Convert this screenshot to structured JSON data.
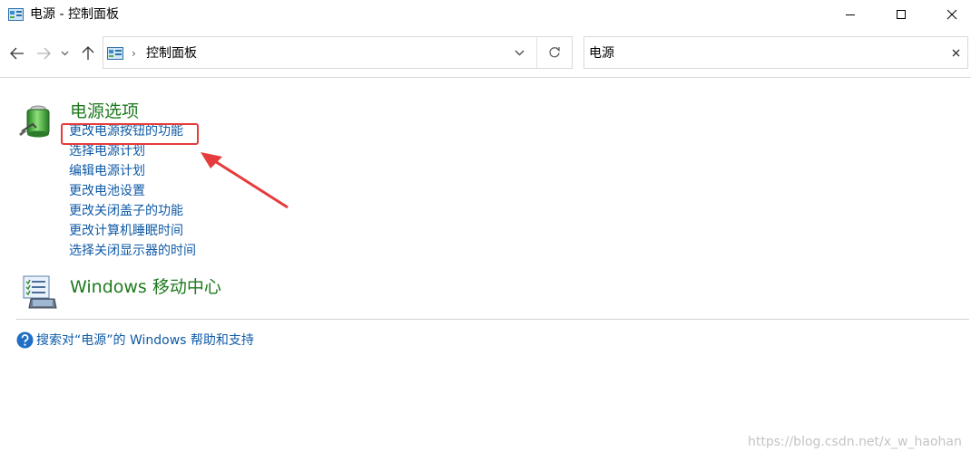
{
  "window": {
    "title": "电源 - 控制面板",
    "icon": "control-panel-icon",
    "controls": [
      "minimize-icon",
      "maximize-icon",
      "close-icon"
    ]
  },
  "nav": {
    "back_icon": "arrow-left-icon",
    "forward_icon": "arrow-right-icon",
    "recent_icon": "chevron-down-icon",
    "up_icon": "arrow-up-icon",
    "address": {
      "icon": "control-panel-icon",
      "separator": "›",
      "path": "控制面板"
    },
    "search": {
      "value": "电源"
    }
  },
  "groups": {
    "power": {
      "title": "电源选项",
      "icon": "battery-icon",
      "links": [
        "更改电源按钮的功能",
        "选择电源计划",
        "编辑电源计划",
        "更改电池设置",
        "更改关闭盖子的功能",
        "更改计算机睡眠时间",
        "选择关闭显示器的时间"
      ]
    },
    "mobility": {
      "title": "Windows 移动中心",
      "icon": "laptop-checklist-icon"
    }
  },
  "help": {
    "text": "搜索对“电源”的 Windows 帮助和支持",
    "icon": "help-icon"
  },
  "annotation": {
    "highlight_color": "#e53b3b"
  },
  "watermark": "https://blog.csdn.net/x_w_haohan",
  "colors": {
    "link": "#0f5aa6",
    "group_title": "#1e7a1e"
  }
}
